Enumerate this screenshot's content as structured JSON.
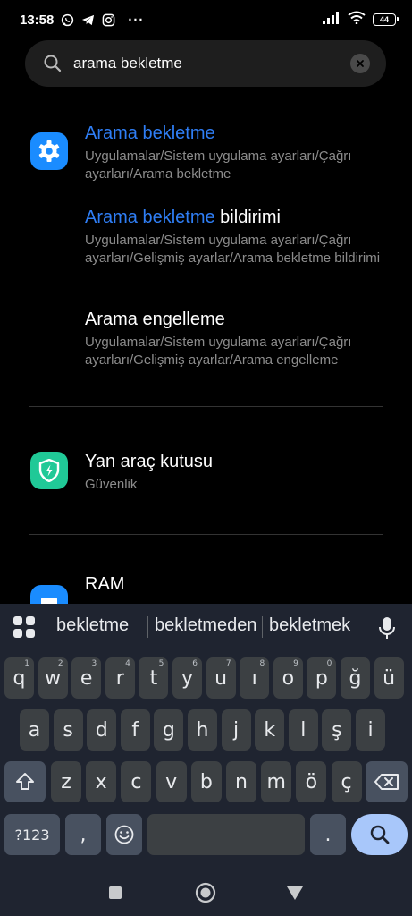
{
  "status": {
    "time": "13:58",
    "battery": "44",
    "more": "···"
  },
  "search": {
    "query": "arama bekletme"
  },
  "results": [
    {
      "title_highlight": "Arama bekletme",
      "title_rest": "",
      "path": "Uygulamalar/Sistem uygulama ayarları/Çağrı ayarları/Arama bekletme",
      "icon": "settings-gear-icon"
    },
    {
      "title_highlight": "Arama bekletme",
      "title_rest": " bildirimi",
      "path": "Uygulamalar/Sistem uygulama ayarları/Çağrı ayarları/Gelişmiş ayarlar/Arama bekletme bildirimi"
    },
    {
      "title_highlight": "",
      "title_rest": "Arama engelleme",
      "path": "Uygulamalar/Sistem uygulama ayarları/Çağrı ayarları/Gelişmiş ayarlar/Arama engelleme"
    },
    {
      "title_highlight": "",
      "title_rest": "Yan araç kutusu",
      "path": "Güvenlik",
      "icon": "security-shield-icon"
    },
    {
      "title_highlight": "",
      "title_rest": "RAM",
      "icon": "ram-icon"
    }
  ],
  "keyboard": {
    "suggestions": [
      "bekletme",
      "bekletmeden",
      "bekletmek"
    ],
    "row1": [
      {
        "k": "q",
        "h": "1"
      },
      {
        "k": "w",
        "h": "2"
      },
      {
        "k": "e",
        "h": "3"
      },
      {
        "k": "r",
        "h": "4"
      },
      {
        "k": "t",
        "h": "5"
      },
      {
        "k": "y",
        "h": "6"
      },
      {
        "k": "u",
        "h": "7"
      },
      {
        "k": "ı",
        "h": "8"
      },
      {
        "k": "o",
        "h": "9"
      },
      {
        "k": "p",
        "h": "0"
      },
      {
        "k": "ğ",
        "h": ""
      },
      {
        "k": "ü",
        "h": ""
      }
    ],
    "row2": [
      "a",
      "s",
      "d",
      "f",
      "g",
      "h",
      "j",
      "k",
      "l",
      "ş",
      "i"
    ],
    "row3": [
      "z",
      "x",
      "c",
      "v",
      "b",
      "n",
      "m",
      "ö",
      "ç"
    ],
    "symbols_label": "?123",
    "comma": ",",
    "period": ".",
    "emoji_icon": "emoji-icon",
    "search_icon": "search-icon"
  },
  "colors": {
    "highlight": "#2f7ef5",
    "settings_icon_bg": "#1a8cff",
    "security_icon_bg": "#20c997",
    "keyboard_bg": "#1f2430",
    "key_bg": "#3c4043",
    "action_key_bg": "#a8c7fa"
  }
}
